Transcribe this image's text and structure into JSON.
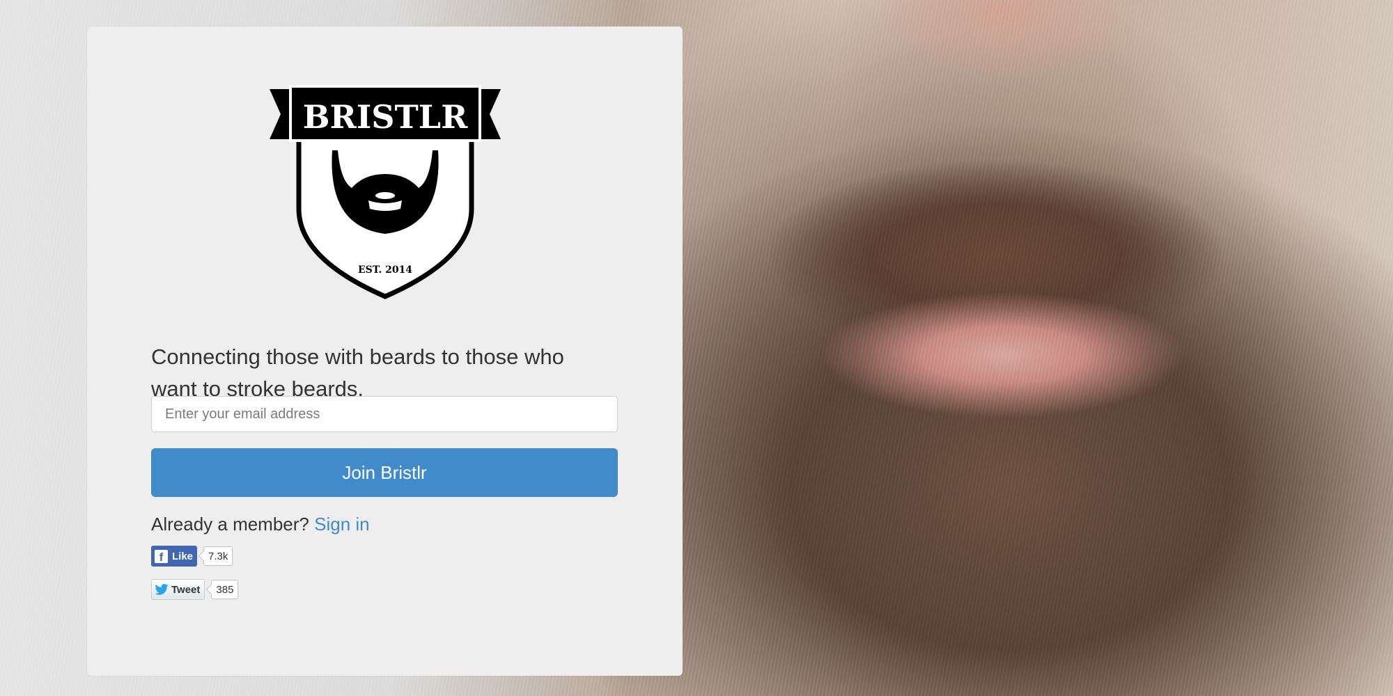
{
  "logo": {
    "brand": "BRISTLR",
    "established": "EST. 2014"
  },
  "signup": {
    "tagline": "Connecting those with beards to those who want to stroke beards.",
    "email_placeholder": "Enter your email address",
    "email_value": "",
    "join_label": "Join Bristlr",
    "member_prompt": "Already a member?",
    "signin_label": "Sign in"
  },
  "social": {
    "facebook": {
      "icon": "facebook-icon",
      "label": "Like",
      "count": "7.3k"
    },
    "twitter": {
      "icon": "twitter-bird-icon",
      "label": "Tweet",
      "count": "385"
    }
  },
  "colors": {
    "accent": "#428bca",
    "card_background": "#eeeeee",
    "facebook_blue": "#4267b2"
  }
}
